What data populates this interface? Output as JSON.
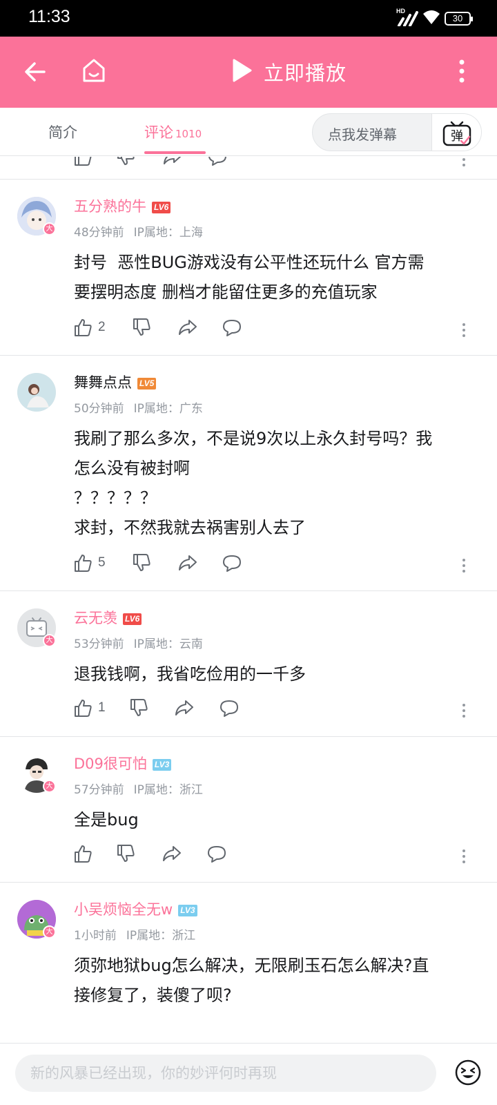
{
  "status_bar": {
    "time": "11:33",
    "battery": "30",
    "network_label": "HD"
  },
  "app_bar": {
    "play_label": "立即播放"
  },
  "tabs": [
    {
      "label": "简介"
    },
    {
      "label": "评论",
      "count": "1010"
    }
  ],
  "danmaku": {
    "placeholder": "点我发弹幕",
    "button_glyph": "弹"
  },
  "comments": [
    {
      "username": "五分熟的牛",
      "level": "LV6",
      "level_color": "#f04c49",
      "username_color": "#fb7299",
      "time": "48分钟前",
      "ip": "IP属地：上海",
      "lines": [
        "封号  恶性BUG游戏没有公平性还玩什么 官方需",
        "要摆明态度 删档才能留住更多的充值玩家"
      ],
      "likes": "2"
    },
    {
      "username": "舞舞点点",
      "level": "LV5",
      "level_color": "#f08937",
      "username_color": "#18191c",
      "time": "50分钟前",
      "ip": "IP属地：广东",
      "lines": [
        "我刷了那么多次，不是说9次以上永久封号吗？我",
        "怎么没有被封啊",
        "？？？？？",
        "求封，不然我就去祸害别人去了"
      ],
      "likes": "5"
    },
    {
      "username": "云无羡",
      "level": "LV6",
      "level_color": "#f04c49",
      "username_color": "#fb7299",
      "time": "53分钟前",
      "ip": "IP属地：云南",
      "lines": [
        "退我钱啊，我省吃俭用的一千多"
      ],
      "likes": "1"
    },
    {
      "username": "D09很可怕",
      "level": "LV3",
      "level_color": "#7bcdef",
      "username_color": "#fb7299",
      "time": "57分钟前",
      "ip": "IP属地：浙江",
      "lines": [
        "全是bug"
      ],
      "likes": ""
    },
    {
      "username": "小吴烦恼全无w",
      "level": "LV3",
      "level_color": "#7bcdef",
      "username_color": "#fb7299",
      "time": "1小时前",
      "ip": "IP属地：浙江",
      "lines": [
        "须弥地狱bug怎么解决，无限刷玉石怎么解决?直",
        "接修复了，装傻了呗?"
      ],
      "likes": ""
    }
  ],
  "avatar_badge": "大",
  "compose": {
    "placeholder": "新的风暴已经出现，你的妙评何时再现"
  },
  "colors": {
    "accent": "#fb7299",
    "muted": "#9499a0",
    "divider": "#e3e5e7"
  }
}
